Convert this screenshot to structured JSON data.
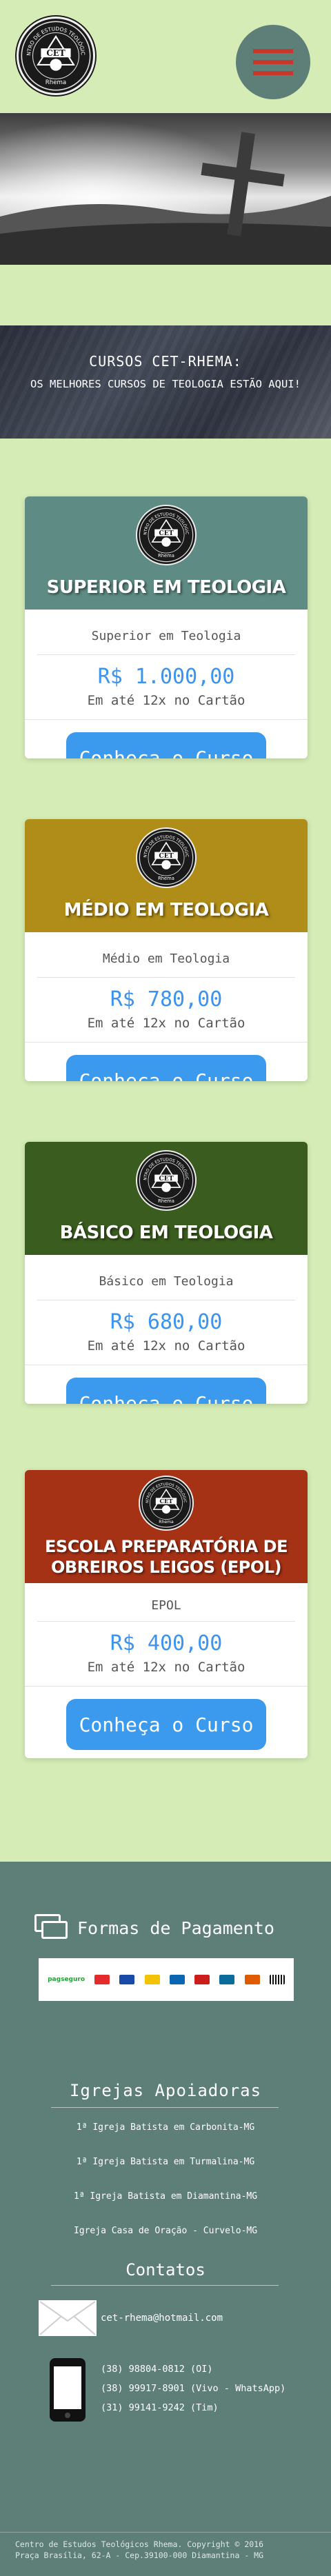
{
  "header": {
    "logo_alt": "Centro de Estudos Teológicos",
    "logo_ring_text": "CENTRO DE ESTUDOS TEOLÓGICOS",
    "logo_bottom": "Rhema",
    "logo_letters": "CET"
  },
  "colors": {
    "page_bg": "#d5ecb6",
    "footer_bg": "#5e7e78",
    "accent_blue": "#3b9aee",
    "menu_bar": "#c7372c"
  },
  "banner": {
    "title": "CURSOS CET-RHEMA:",
    "subtitle": "OS MELHORES CURSOS DE TEOLOGIA ESTÃO AQUI!"
  },
  "courses": [
    {
      "header": "SUPERIOR EM TEOLOGIA",
      "color": "#5e8b83",
      "name": "Superior em Teologia",
      "price": "R$ 1.000,00",
      "installments": "Em até 12x no Cartão",
      "button": "Conheça o Curso"
    },
    {
      "header": "MÉDIO EM TEOLOGIA",
      "color": "#b08c18",
      "name": "Médio em Teologia",
      "price": "R$ 780,00",
      "installments": "Em até 12x no Cartão",
      "button": "Conheça o Curso"
    },
    {
      "header": "BÁSICO EM TEOLOGIA",
      "color": "#3a5c1e",
      "name": "Básico em Teologia",
      "price": "R$ 680,00",
      "installments": "Em até 12x no Cartão",
      "button": "Conheça o Curso"
    },
    {
      "header": "ESCOLA PREPARATÓRIA DE OBREIROS LEIGOS (EPOL)",
      "color": "#a63216",
      "name": "EPOL",
      "price": "R$ 400,00",
      "installments": "Em até 12x no Cartão",
      "button": "Conheça o Curso"
    }
  ],
  "payment": {
    "title": "Formas de Pagamento",
    "brand": "pagseguro"
  },
  "igrejas": {
    "title": "Igrejas Apoiadoras",
    "items": [
      "1ª Igreja Batista em Carbonita-MG",
      "1ª Igreja Batista em Turmalina-MG",
      "1ª Igreja Batista em Diamantina-MG",
      "Igreja Casa de Oração - Curvelo-MG"
    ]
  },
  "contatos": {
    "title": "Contatos",
    "email": "cet-rhema@hotmail.com",
    "phones": [
      "(38) 98804-0812 (OI)",
      "(38) 99917-8901 (Vivo - WhatsApp)",
      "(31) 99141-9242 (Tim)"
    ]
  },
  "footer": {
    "copyright_line1": "Centro de Estudos Teológicos Rhema. Copyright © 2016",
    "copyright_line2": "Praça Brasília, 62-A - Cep.39100-000 Diamantina - MG"
  }
}
